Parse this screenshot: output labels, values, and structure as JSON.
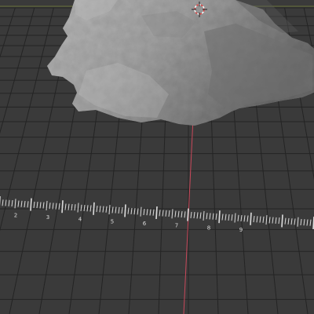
{
  "viewport": {
    "label": "3D viewport",
    "background": "#3a3a3a",
    "grid_color": "#242424",
    "y_axis_color": "#c8485a",
    "x_axis_color": "#8a9a3a"
  },
  "rock": {
    "name": "rock-scan-mesh",
    "base_color": "#9a9a9a",
    "shadow_color": "#5e5e5e",
    "highlight_color": "#c4c4c4"
  },
  "cursor_3d": {
    "name": "3d-cursor-icon"
  },
  "ruler": {
    "tick_color": "#dcdcdc",
    "labels": [
      "2",
      "3",
      "4",
      "5",
      "6",
      "7",
      "8",
      "9"
    ]
  }
}
